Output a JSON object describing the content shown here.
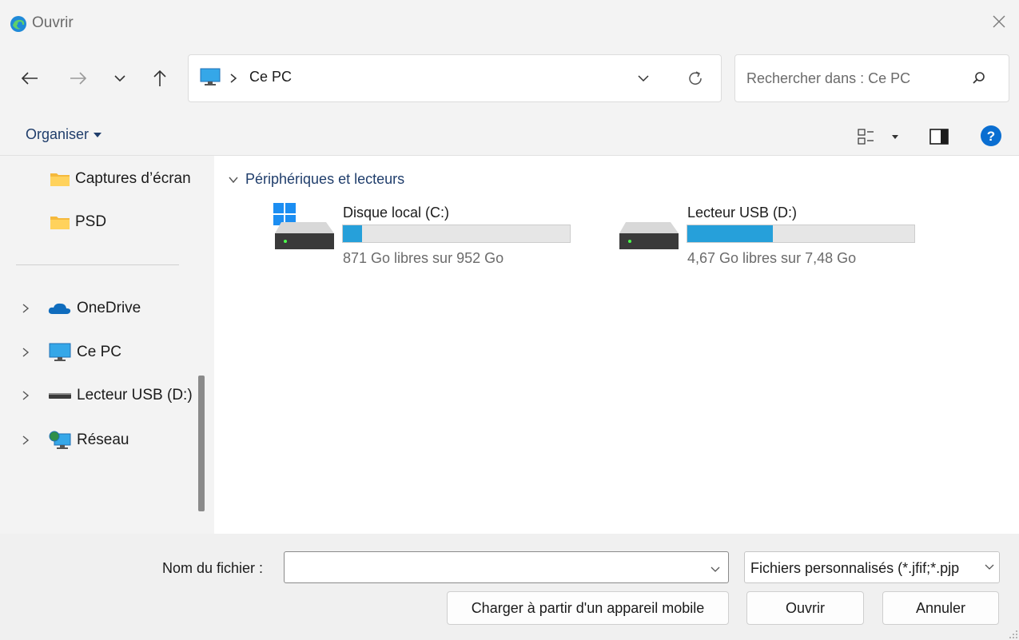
{
  "window": {
    "title": "Ouvrir"
  },
  "address_bar": {
    "current": "Ce PC"
  },
  "search": {
    "placeholder": "Rechercher dans : Ce PC"
  },
  "toolbar": {
    "organize_label": "Organiser"
  },
  "sidebar": {
    "quick_access": [
      {
        "label": "Captures d’écran",
        "icon": "folder-icon"
      },
      {
        "label": "PSD",
        "icon": "folder-icon"
      }
    ],
    "locations": [
      {
        "label": "OneDrive",
        "icon": "cloud-icon"
      },
      {
        "label": "Ce PC",
        "icon": "monitor-icon"
      },
      {
        "label": "Lecteur USB (D:)",
        "icon": "usb-drive-icon"
      },
      {
        "label": "Réseau",
        "icon": "network-icon"
      }
    ]
  },
  "main": {
    "section_title": "Périphériques et lecteurs",
    "drives": [
      {
        "name": "Disque local (C:)",
        "free_text": "871 Go libres sur 952 Go",
        "used_fraction": 0.085,
        "icon": "windows-drive-icon"
      },
      {
        "name": "Lecteur USB (D:)",
        "free_text": "4,67 Go libres sur 7,48 Go",
        "used_fraction": 0.376,
        "icon": "usb-drive-icon"
      }
    ]
  },
  "footer": {
    "filename_label": "Nom du fichier :",
    "filename_value": "",
    "filter_value": "Fichiers personnalisés (*.jfif;*.pjp",
    "mobile_button": "Charger à partir d'un appareil mobile",
    "open_button": "Ouvrir",
    "cancel_button": "Annuler"
  },
  "colors": {
    "accent": "#26a0da",
    "link": "#1f3d6b",
    "help": "#0a6ed1"
  }
}
